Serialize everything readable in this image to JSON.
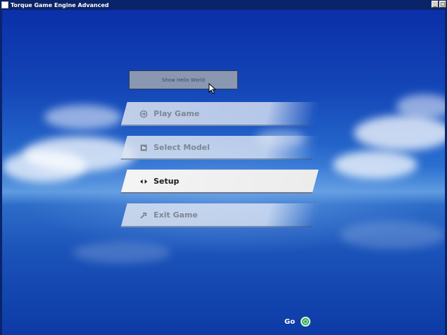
{
  "window": {
    "title": "Torque Game Engine Advanced",
    "buttons": {
      "minimize": "_",
      "maximize": "□"
    }
  },
  "hello_button": {
    "label": "Show Hello World"
  },
  "menu": [
    {
      "label": "Play Game",
      "icon": "play-arrow-icon"
    },
    {
      "label": "Select Model",
      "icon": "model-icon"
    },
    {
      "label": "Setup",
      "icon": "setup-arrows-icon",
      "state": "hovered"
    },
    {
      "label": "Exit Game",
      "icon": "exit-icon"
    }
  ],
  "go": {
    "label": "Go",
    "icon": "go-icon",
    "color": "#2da85a"
  },
  "colors": {
    "sky_top": "#0b2fa8",
    "horizon": "#5f9be0",
    "titlebar": "#0a246a"
  }
}
